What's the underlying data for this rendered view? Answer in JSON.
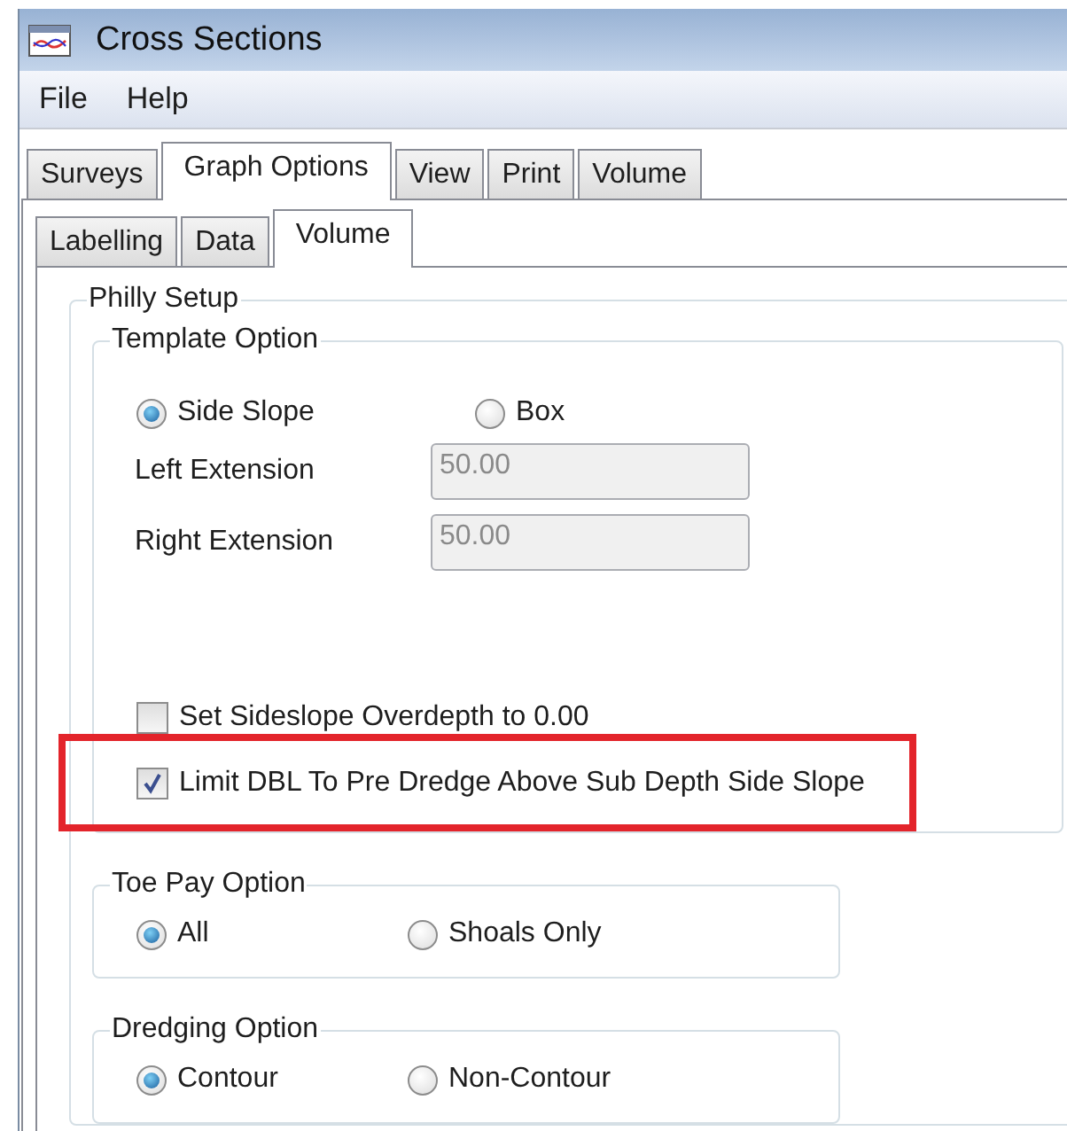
{
  "window": {
    "title": "Cross Sections"
  },
  "menu": [
    {
      "label": "File"
    },
    {
      "label": "Help"
    }
  ],
  "tabs": [
    {
      "label": "Surveys",
      "selected": false
    },
    {
      "label": "Graph Options",
      "selected": true
    },
    {
      "label": "View",
      "selected": false
    },
    {
      "label": "Print",
      "selected": false
    },
    {
      "label": "Volume",
      "selected": false
    }
  ],
  "subtabs": [
    {
      "label": "Labelling",
      "selected": false
    },
    {
      "label": "Data",
      "selected": false
    },
    {
      "label": "Volume",
      "selected": true
    }
  ],
  "philly_setup": {
    "title": "Philly Setup",
    "template_option": {
      "title": "Template Option",
      "options": [
        {
          "label": "Side Slope",
          "selected": true
        },
        {
          "label": "Box",
          "selected": false
        }
      ],
      "fields": [
        {
          "label": "Left Extension",
          "value": "50.00",
          "disabled": true
        },
        {
          "label": "Right Extension",
          "value": "50.00",
          "disabled": true
        }
      ],
      "checkboxes": [
        {
          "label": "Set Sideslope Overdepth to 0.00",
          "checked": false,
          "highlighted": false
        },
        {
          "label": "Limit DBL To Pre Dredge Above Sub Depth Side Slope",
          "checked": true,
          "highlighted": true
        }
      ]
    },
    "option_groups": [
      {
        "title": "Toe Pay Option",
        "options": [
          {
            "label": "All",
            "selected": true
          },
          {
            "label": "Shoals Only",
            "selected": false
          }
        ]
      },
      {
        "title": "Dredging Option",
        "options": [
          {
            "label": "Contour",
            "selected": true
          },
          {
            "label": "Non-Contour",
            "selected": false
          }
        ]
      }
    ]
  }
}
